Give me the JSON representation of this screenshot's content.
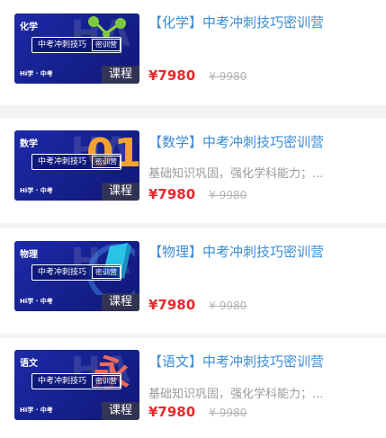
{
  "courses": [
    {
      "subject": "化学",
      "title": "【化学】中考冲刺技巧密训营",
      "description": "",
      "price": "¥7980",
      "original_price": "¥ 9980",
      "thumb_banner": "中考冲刺技巧",
      "thumb_tag": "密训营",
      "thumb_brand": "Hi学 · 中考",
      "thumb_course": "课程",
      "deco": "molecule"
    },
    {
      "subject": "数学",
      "title": "【数学】中考冲刺技巧密训营",
      "description": "基础知识巩固，强化学科能力；...",
      "price": "¥7980",
      "original_price": "¥ 9980",
      "thumb_banner": "中考冲刺技巧",
      "thumb_tag": "密训营",
      "thumb_brand": "Hi学 · 中考",
      "thumb_course": "课程",
      "deco": "01"
    },
    {
      "subject": "物理",
      "title": "【物理】中考冲刺技巧密训营",
      "description": "",
      "price": "¥7980",
      "original_price": "¥ 9980",
      "thumb_banner": "中考冲刺技巧",
      "thumb_tag": "密训营",
      "thumb_brand": "Hi学 · 中考",
      "thumb_course": "课程",
      "deco": "prism"
    },
    {
      "subject": "语文",
      "title": "【语文】中考冲刺技巧密训营",
      "description": "基础知识巩固，强化学科能力；...",
      "price": "¥7980",
      "original_price": "¥ 9980",
      "thumb_banner": "中考冲刺技巧",
      "thumb_tag": "密训营",
      "thumb_brand": "Hi学 · 中考",
      "thumb_course": "课程",
      "deco": "永"
    }
  ],
  "colors": {
    "title": "#3c8dd6",
    "price": "#e7292b",
    "thumb_bg": "#1e2aa8"
  }
}
